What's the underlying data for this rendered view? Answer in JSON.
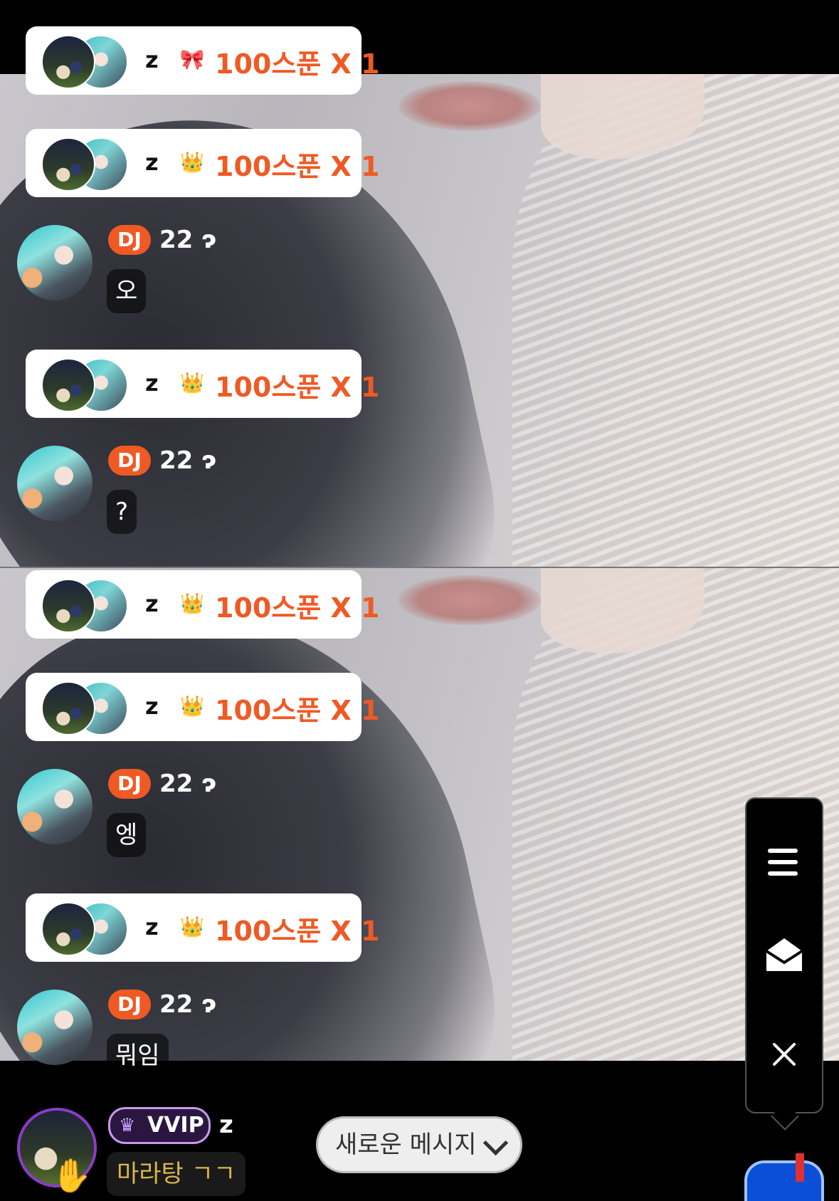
{
  "gift_messages": [
    {
      "user": "z",
      "icon": "🎀",
      "amount": "100스푼 X 1"
    },
    {
      "user": "z",
      "icon": "👑",
      "amount": "100스푼 X 1"
    },
    {
      "user": "z",
      "icon": "👑",
      "amount": "100스푼 X 1"
    },
    {
      "user": "z",
      "icon": "👑",
      "amount": "100스푼 X 1"
    },
    {
      "user": "z",
      "icon": "👑",
      "amount": "100스푼 X 1"
    },
    {
      "user": "z",
      "icon": "👑",
      "amount": "100스푼 X 1"
    }
  ],
  "chat_messages": [
    {
      "badge": "DJ",
      "nickname": "22 ɂ",
      "text": "오"
    },
    {
      "badge": "DJ",
      "nickname": "22 ɂ",
      "text": "?"
    },
    {
      "badge": "DJ",
      "nickname": "22 ɂ",
      "text": "엥"
    },
    {
      "badge": "DJ",
      "nickname": "22 ɂ",
      "text": "뭐임"
    }
  ],
  "my_message": {
    "badge": "VVIP",
    "nickname": "z",
    "text": "마라탕 ㄱㄱ"
  },
  "new_message_button": "새로운 메시지",
  "side_panel": {
    "menu_icon": "menu-icon",
    "mail_icon": "open-mail-icon",
    "close_icon": "close-icon"
  },
  "colors": {
    "accent": "#ef5a24",
    "vvip_border": "#c79ae6",
    "my_text": "#d8b64a"
  }
}
